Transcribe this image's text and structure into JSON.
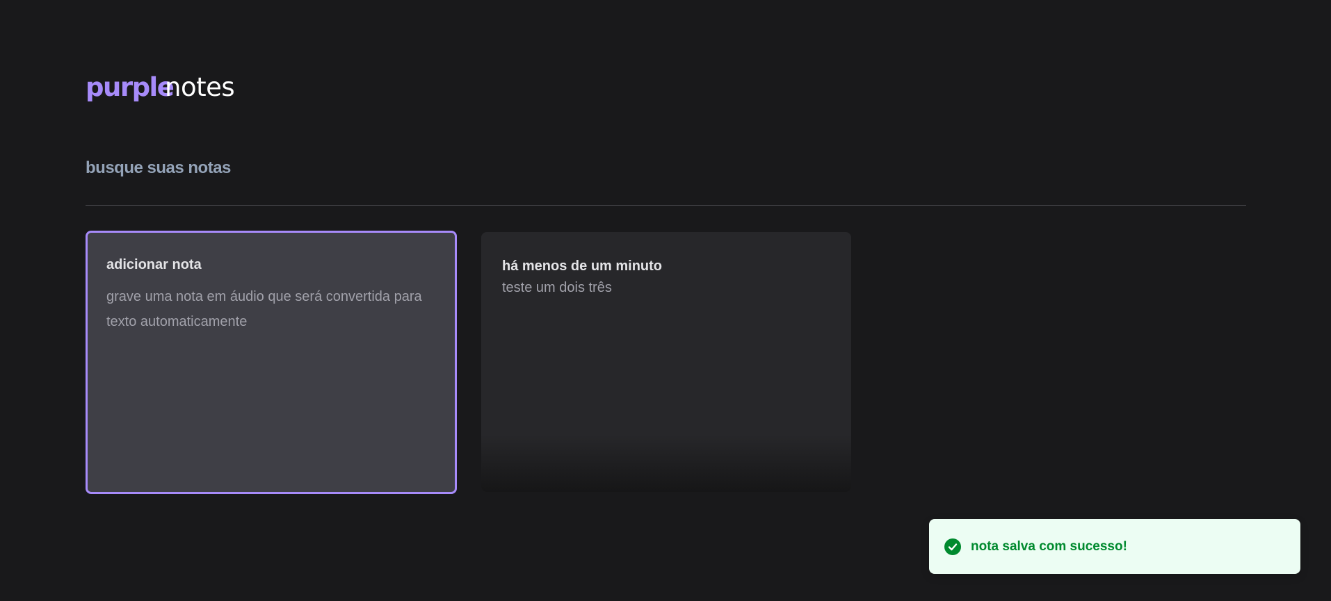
{
  "app": {
    "logo_primary": "purple",
    "logo_secondary": "notes"
  },
  "search": {
    "placeholder": "busque suas notas",
    "value": ""
  },
  "add_card": {
    "title": "adicionar nota",
    "description": "grave uma nota em áudio que será convertida para texto automaticamente"
  },
  "notes": [
    {
      "date": "há menos de um minuto",
      "content": "teste um dois três"
    }
  ],
  "toast": {
    "message": "nota salva com sucesso!",
    "icon": "check-circle-icon"
  },
  "colors": {
    "accent": "#a78bfa",
    "background": "#19191b",
    "toast_success": "#008a2e"
  }
}
